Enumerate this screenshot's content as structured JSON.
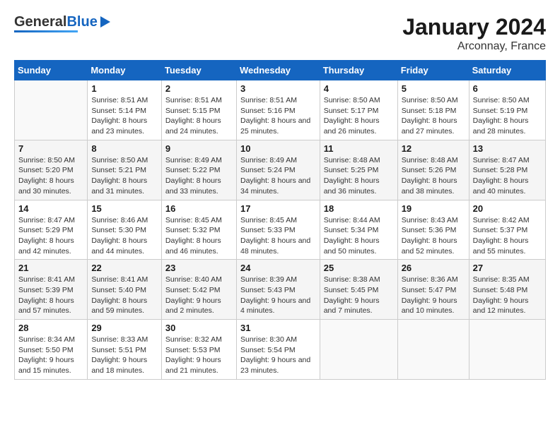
{
  "header": {
    "title": "January 2024",
    "subtitle": "Arconnay, France",
    "logo_general": "General",
    "logo_blue": "Blue"
  },
  "days_of_week": [
    "Sunday",
    "Monday",
    "Tuesday",
    "Wednesday",
    "Thursday",
    "Friday",
    "Saturday"
  ],
  "weeks": [
    [
      {
        "day": "",
        "sunrise": "",
        "sunset": "",
        "daylight": ""
      },
      {
        "day": "1",
        "sunrise": "Sunrise: 8:51 AM",
        "sunset": "Sunset: 5:14 PM",
        "daylight": "Daylight: 8 hours and 23 minutes."
      },
      {
        "day": "2",
        "sunrise": "Sunrise: 8:51 AM",
        "sunset": "Sunset: 5:15 PM",
        "daylight": "Daylight: 8 hours and 24 minutes."
      },
      {
        "day": "3",
        "sunrise": "Sunrise: 8:51 AM",
        "sunset": "Sunset: 5:16 PM",
        "daylight": "Daylight: 8 hours and 25 minutes."
      },
      {
        "day": "4",
        "sunrise": "Sunrise: 8:50 AM",
        "sunset": "Sunset: 5:17 PM",
        "daylight": "Daylight: 8 hours and 26 minutes."
      },
      {
        "day": "5",
        "sunrise": "Sunrise: 8:50 AM",
        "sunset": "Sunset: 5:18 PM",
        "daylight": "Daylight: 8 hours and 27 minutes."
      },
      {
        "day": "6",
        "sunrise": "Sunrise: 8:50 AM",
        "sunset": "Sunset: 5:19 PM",
        "daylight": "Daylight: 8 hours and 28 minutes."
      }
    ],
    [
      {
        "day": "7",
        "sunrise": "Sunrise: 8:50 AM",
        "sunset": "Sunset: 5:20 PM",
        "daylight": "Daylight: 8 hours and 30 minutes."
      },
      {
        "day": "8",
        "sunrise": "Sunrise: 8:50 AM",
        "sunset": "Sunset: 5:21 PM",
        "daylight": "Daylight: 8 hours and 31 minutes."
      },
      {
        "day": "9",
        "sunrise": "Sunrise: 8:49 AM",
        "sunset": "Sunset: 5:22 PM",
        "daylight": "Daylight: 8 hours and 33 minutes."
      },
      {
        "day": "10",
        "sunrise": "Sunrise: 8:49 AM",
        "sunset": "Sunset: 5:24 PM",
        "daylight": "Daylight: 8 hours and 34 minutes."
      },
      {
        "day": "11",
        "sunrise": "Sunrise: 8:48 AM",
        "sunset": "Sunset: 5:25 PM",
        "daylight": "Daylight: 8 hours and 36 minutes."
      },
      {
        "day": "12",
        "sunrise": "Sunrise: 8:48 AM",
        "sunset": "Sunset: 5:26 PM",
        "daylight": "Daylight: 8 hours and 38 minutes."
      },
      {
        "day": "13",
        "sunrise": "Sunrise: 8:47 AM",
        "sunset": "Sunset: 5:28 PM",
        "daylight": "Daylight: 8 hours and 40 minutes."
      }
    ],
    [
      {
        "day": "14",
        "sunrise": "Sunrise: 8:47 AM",
        "sunset": "Sunset: 5:29 PM",
        "daylight": "Daylight: 8 hours and 42 minutes."
      },
      {
        "day": "15",
        "sunrise": "Sunrise: 8:46 AM",
        "sunset": "Sunset: 5:30 PM",
        "daylight": "Daylight: 8 hours and 44 minutes."
      },
      {
        "day": "16",
        "sunrise": "Sunrise: 8:45 AM",
        "sunset": "Sunset: 5:32 PM",
        "daylight": "Daylight: 8 hours and 46 minutes."
      },
      {
        "day": "17",
        "sunrise": "Sunrise: 8:45 AM",
        "sunset": "Sunset: 5:33 PM",
        "daylight": "Daylight: 8 hours and 48 minutes."
      },
      {
        "day": "18",
        "sunrise": "Sunrise: 8:44 AM",
        "sunset": "Sunset: 5:34 PM",
        "daylight": "Daylight: 8 hours and 50 minutes."
      },
      {
        "day": "19",
        "sunrise": "Sunrise: 8:43 AM",
        "sunset": "Sunset: 5:36 PM",
        "daylight": "Daylight: 8 hours and 52 minutes."
      },
      {
        "day": "20",
        "sunrise": "Sunrise: 8:42 AM",
        "sunset": "Sunset: 5:37 PM",
        "daylight": "Daylight: 8 hours and 55 minutes."
      }
    ],
    [
      {
        "day": "21",
        "sunrise": "Sunrise: 8:41 AM",
        "sunset": "Sunset: 5:39 PM",
        "daylight": "Daylight: 8 hours and 57 minutes."
      },
      {
        "day": "22",
        "sunrise": "Sunrise: 8:41 AM",
        "sunset": "Sunset: 5:40 PM",
        "daylight": "Daylight: 8 hours and 59 minutes."
      },
      {
        "day": "23",
        "sunrise": "Sunrise: 8:40 AM",
        "sunset": "Sunset: 5:42 PM",
        "daylight": "Daylight: 9 hours and 2 minutes."
      },
      {
        "day": "24",
        "sunrise": "Sunrise: 8:39 AM",
        "sunset": "Sunset: 5:43 PM",
        "daylight": "Daylight: 9 hours and 4 minutes."
      },
      {
        "day": "25",
        "sunrise": "Sunrise: 8:38 AM",
        "sunset": "Sunset: 5:45 PM",
        "daylight": "Daylight: 9 hours and 7 minutes."
      },
      {
        "day": "26",
        "sunrise": "Sunrise: 8:36 AM",
        "sunset": "Sunset: 5:47 PM",
        "daylight": "Daylight: 9 hours and 10 minutes."
      },
      {
        "day": "27",
        "sunrise": "Sunrise: 8:35 AM",
        "sunset": "Sunset: 5:48 PM",
        "daylight": "Daylight: 9 hours and 12 minutes."
      }
    ],
    [
      {
        "day": "28",
        "sunrise": "Sunrise: 8:34 AM",
        "sunset": "Sunset: 5:50 PM",
        "daylight": "Daylight: 9 hours and 15 minutes."
      },
      {
        "day": "29",
        "sunrise": "Sunrise: 8:33 AM",
        "sunset": "Sunset: 5:51 PM",
        "daylight": "Daylight: 9 hours and 18 minutes."
      },
      {
        "day": "30",
        "sunrise": "Sunrise: 8:32 AM",
        "sunset": "Sunset: 5:53 PM",
        "daylight": "Daylight: 9 hours and 21 minutes."
      },
      {
        "day": "31",
        "sunrise": "Sunrise: 8:30 AM",
        "sunset": "Sunset: 5:54 PM",
        "daylight": "Daylight: 9 hours and 23 minutes."
      },
      {
        "day": "",
        "sunrise": "",
        "sunset": "",
        "daylight": ""
      },
      {
        "day": "",
        "sunrise": "",
        "sunset": "",
        "daylight": ""
      },
      {
        "day": "",
        "sunrise": "",
        "sunset": "",
        "daylight": ""
      }
    ]
  ]
}
